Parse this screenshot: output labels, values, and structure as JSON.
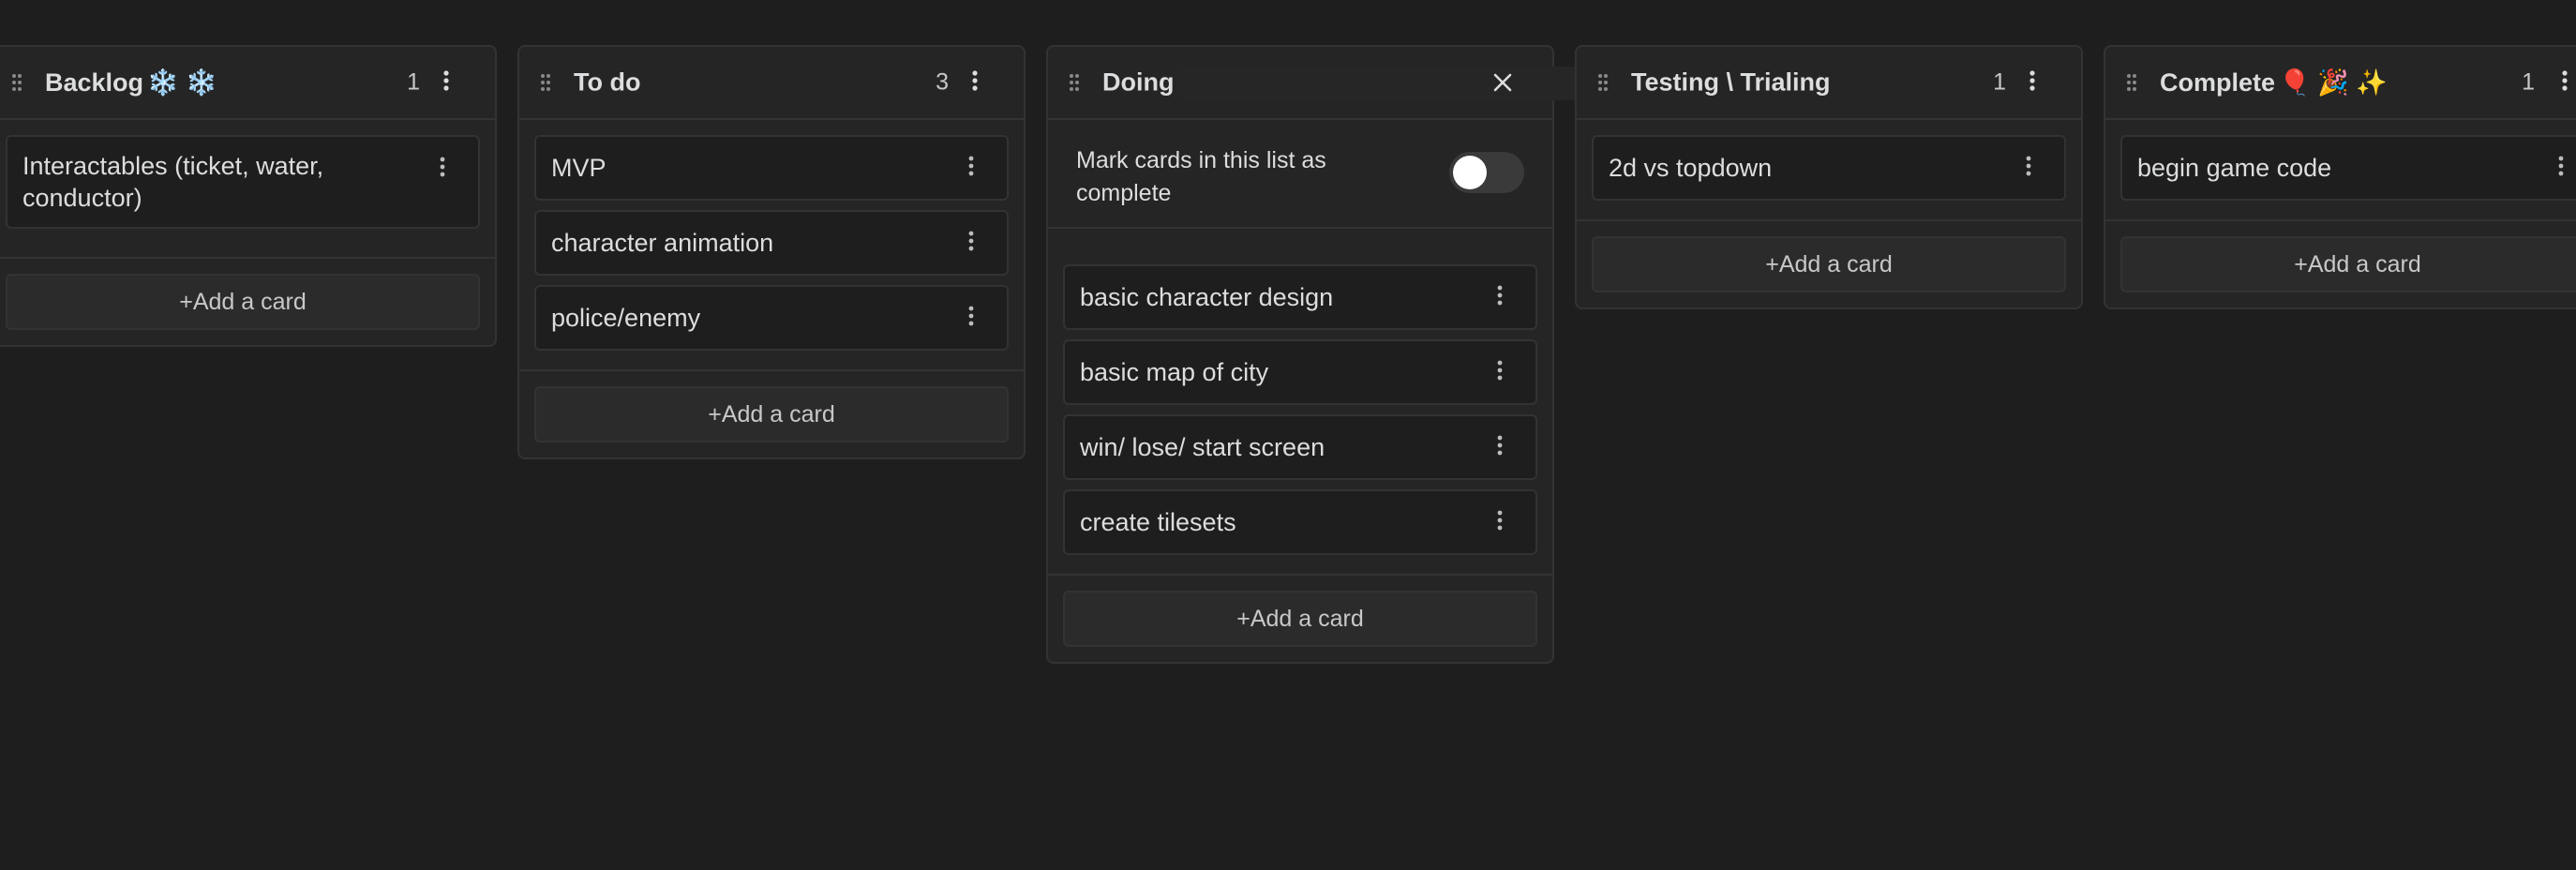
{
  "lanes": [
    {
      "title": "Backlog",
      "title_emoji": "❄️ ❄️",
      "count": "1",
      "cards": [
        "Interactables (ticket, water, conductor)"
      ],
      "add_label": "+Add a card"
    },
    {
      "title": "To do",
      "title_emoji": "",
      "count": "3",
      "cards": [
        "MVP",
        "character animation",
        "police/enemy"
      ],
      "add_label": "+Add a card"
    },
    {
      "title": "Doing",
      "title_emoji": "",
      "count": "",
      "settings_label": "Mark cards in this list as complete",
      "toggle_on": false,
      "cards": [
        "basic character design",
        "basic map of city",
        "win/ lose/ start screen",
        "create tilesets"
      ],
      "add_label": "+Add a card"
    },
    {
      "title": "Testing \\ Trialing",
      "title_emoji": "",
      "count": "1",
      "cards": [
        "2d vs topdown"
      ],
      "add_label": "+Add a card"
    },
    {
      "title": "Complete",
      "title_emoji": "🎈 🎉 ✨",
      "count": "1",
      "cards": [
        "begin game code"
      ],
      "add_label": "+Add a card"
    }
  ],
  "icons": {
    "drag": "drag-handle-icon",
    "more": "more-vertical-icon",
    "close": "close-icon"
  },
  "colors": {
    "background": "#1e1e1e",
    "lane": "#252525",
    "border": "#333333",
    "text": "#dcddde"
  }
}
